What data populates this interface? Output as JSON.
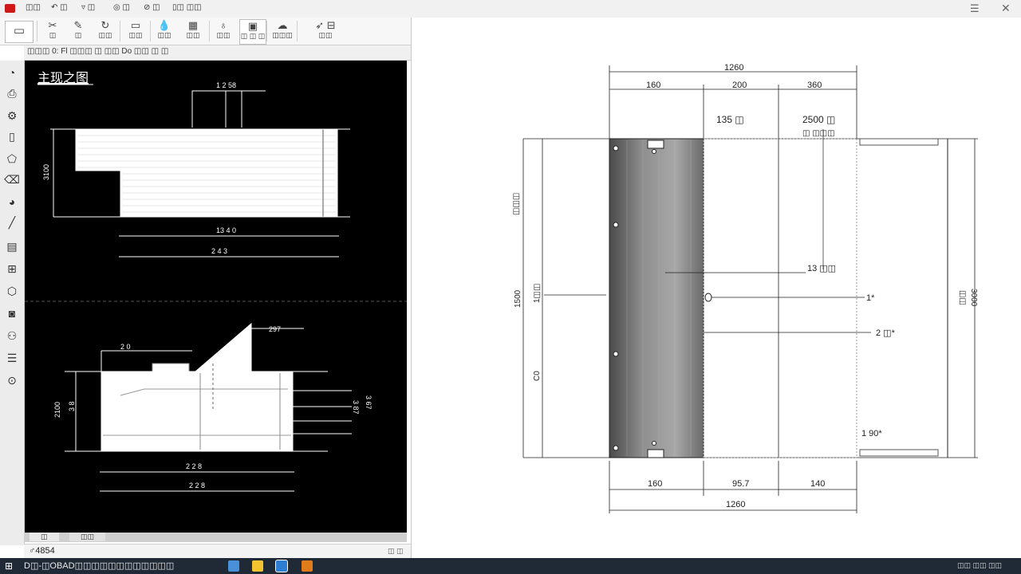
{
  "titlebar": {
    "items": [
      "◫◫",
      "↶ ◫",
      "▿ ◫",
      "◎ ◫",
      "⊘ ◫",
      "▯◫ ◫◫"
    ],
    "menu_icon": "hamburger-icon",
    "close_icon": "close-icon"
  },
  "ribbon": {
    "buttons": [
      {
        "name": "layer-tool",
        "label": "◫",
        "icon": "monitor-icon"
      },
      {
        "name": "cut-tool",
        "label": "◫",
        "icon": "scissors-icon"
      },
      {
        "name": "edit-tool",
        "label": "◫",
        "icon": "pencil-icon"
      },
      {
        "name": "rotate-tool",
        "label": "◫◫",
        "icon": "rotate-icon"
      },
      {
        "name": "rect-tool",
        "label": "◫◫",
        "icon": "rectangle-icon"
      },
      {
        "name": "fill-tool",
        "label": "◫◫",
        "icon": "droplet-icon"
      },
      {
        "name": "table-tool",
        "label": "◫◫",
        "icon": "table-icon"
      },
      {
        "name": "brush-tool",
        "label": "◫◫",
        "icon": "brush-icon"
      },
      {
        "name": "grid-tool",
        "label": "◫ ◫ ◫",
        "icon": "grid-icon"
      },
      {
        "name": "cloud-tool",
        "label": "◫◫◫",
        "icon": "cloud-icon"
      },
      {
        "name": "arrow-tool",
        "label": "◫◫",
        "icon": "pointer-icon"
      }
    ]
  },
  "tabstrip": {
    "text": "◫◫◫ 0: Fl  ◫◫◫ ◫ ◫◫ Do ◫◫  ◫ ◫"
  },
  "canvas": {
    "front_view_title": "主现之图",
    "top": {
      "dims": [
        "1 2 58",
        "3100",
        "13 4 0",
        "2 4 3"
      ]
    },
    "bottom": {
      "dims": [
        "297",
        "2 0",
        "2100",
        "3 8",
        "3 87",
        "3 67",
        "2 2 8",
        "2 2 8"
      ]
    }
  },
  "canvas_tabs": [
    "◫",
    "◫◫"
  ],
  "status": {
    "left": "♂4854",
    "right": "◫ ◫"
  },
  "sheet": {
    "top_dims": [
      "1260",
      "160",
      "200",
      "360"
    ],
    "annot": [
      "135 ◫",
      "2500 ◫",
      "◫ ◫◫◫"
    ],
    "side_left": [
      "◫◫◫",
      "1500",
      "1◫◫",
      "C0"
    ],
    "side_right": [
      "◫◫",
      "3000"
    ],
    "callouts": [
      "13 ◫◫",
      "1*",
      "2 ◫*",
      "1 90*"
    ],
    "bottom_dims": [
      "160",
      "95.7",
      "140",
      "1260"
    ]
  },
  "taskbar": {
    "path": "D◫-◫OBAD◫◫◫◫◫◫◫◫◫◫◫◫",
    "tray": "◫◫ ◫◫ ◫◫"
  }
}
